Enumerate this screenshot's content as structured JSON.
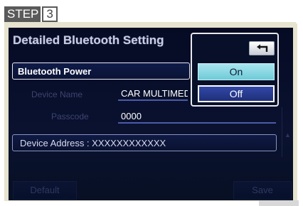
{
  "step": {
    "label": "STEP",
    "number": "3"
  },
  "screen": {
    "title": "Detailed Bluetooth Setting",
    "bluetooth_power_label": "Bluetooth Power",
    "device_name": {
      "label": "Device Name",
      "value": "CAR MULTIMEDIA"
    },
    "passcode": {
      "label": "Passcode",
      "value": "0000"
    },
    "device_address": "Device Address : XXXXXXXXXXXX",
    "default_label": "Default",
    "save_label": "Save"
  },
  "popup": {
    "back_icon": "return-arrow-icon",
    "options": [
      "On",
      "Off"
    ],
    "selected": "Off"
  },
  "colors": {
    "screen_bg": "#0a1230",
    "on_highlight": "#8dd8e4",
    "off_selected": "#2a3d94"
  }
}
